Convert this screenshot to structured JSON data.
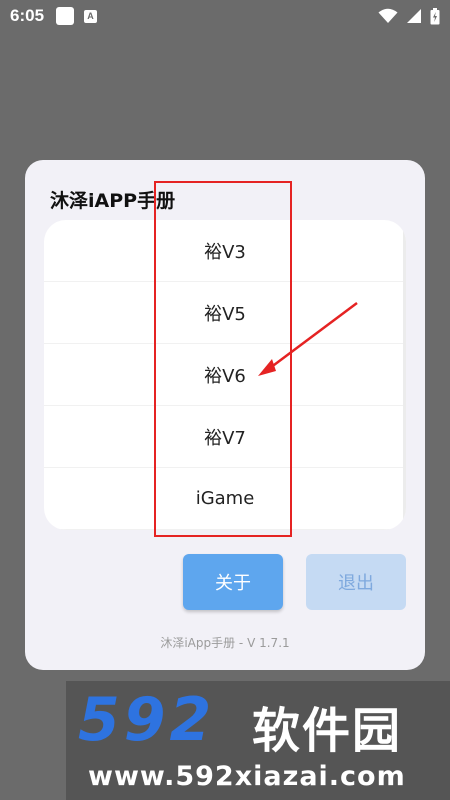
{
  "status_bar": {
    "time": "6:05",
    "icons": [
      "square-notification-icon",
      "a-notification-icon",
      "wifi-icon",
      "signal-icon",
      "battery-charging-icon"
    ]
  },
  "dialog": {
    "title": "沐泽iAPP手册",
    "items": [
      {
        "label": "裕V3"
      },
      {
        "label": "裕V5"
      },
      {
        "label": "裕V6"
      },
      {
        "label": "裕V7"
      },
      {
        "label": "iGame"
      }
    ],
    "about_button": "关于",
    "exit_button": "退出",
    "footer": "沐泽iApp手册 - V 1.7.1"
  },
  "annotation": {
    "box_color": "#e52323",
    "arrow_target": "裕V6"
  },
  "watermark": {
    "number": "592",
    "brand": "软件园",
    "url": "www.592xiazai.com"
  },
  "colors": {
    "background": "#6b6b6b",
    "dialog": "#f2f1f7",
    "primary_button": "#5ea6ee",
    "disabled_button": "#c5daf3",
    "watermark_blue": "#2e73e0"
  }
}
